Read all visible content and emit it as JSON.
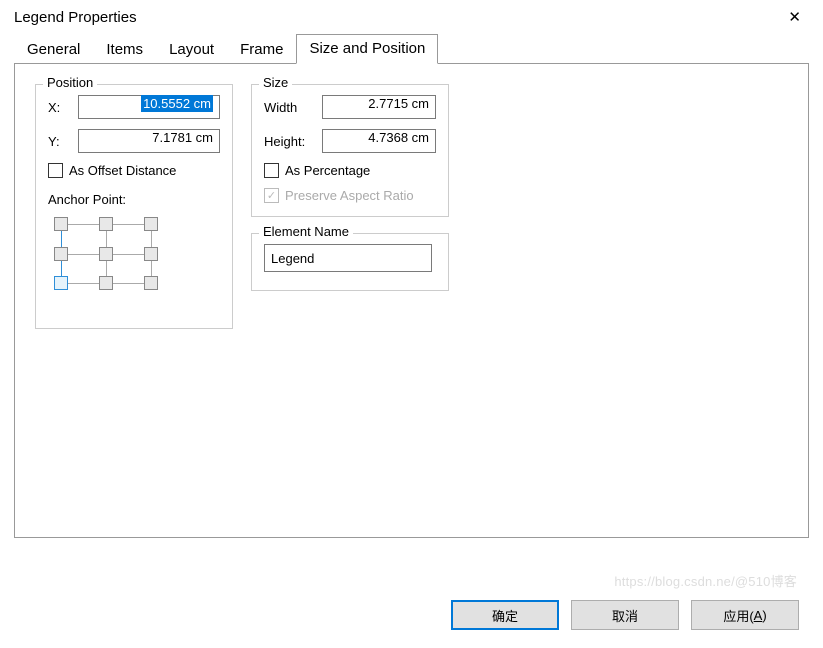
{
  "window": {
    "title": "Legend Properties"
  },
  "tabs": {
    "items": [
      "General",
      "Items",
      "Layout",
      "Frame",
      "Size and Position"
    ],
    "activeIndex": 4
  },
  "position": {
    "legend": "Position",
    "x_label": "X:",
    "x_value": "10.5552 cm",
    "y_label": "Y:",
    "y_value": "7.1781 cm",
    "as_offset_label": "As Offset Distance",
    "anchor_label": "Anchor Point:"
  },
  "size": {
    "legend": "Size",
    "width_label": "Width",
    "width_value": "2.7715 cm",
    "height_label": "Height:",
    "height_value": "4.7368 cm",
    "as_percentage_label": "As Percentage",
    "preserve_ratio_label": "Preserve Aspect Ratio"
  },
  "element_name": {
    "legend": "Element Name",
    "value": "Legend"
  },
  "buttons": {
    "ok": "确定",
    "cancel": "取消",
    "apply": "应用(",
    "apply_key": "A",
    "apply_suffix": ")"
  },
  "watermark": "https://blog.csdn.ne/@510博客"
}
